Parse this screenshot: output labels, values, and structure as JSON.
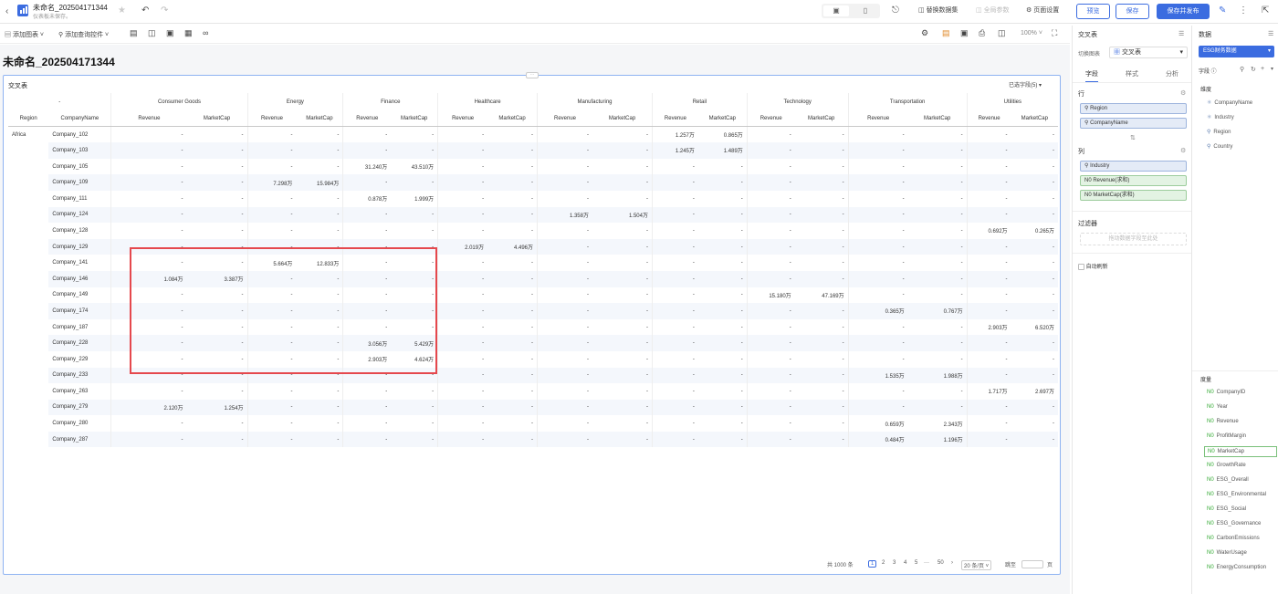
{
  "app": {
    "title": "未命名_202504171344",
    "subtitle": "仪表板未保存。"
  },
  "header": {
    "actions": {
      "replace_dataset": "替换数据集",
      "global_params": "全局参数",
      "page_settings": "页面设置"
    },
    "buttons": {
      "preview": "预览",
      "save": "保存",
      "save_publish": "保存并发布"
    }
  },
  "toolbar": {
    "add_chart": "添加图表",
    "add_query_control": "添加查询控件",
    "zoom": "100%"
  },
  "page": {
    "title": "未命名_202504171344"
  },
  "widget": {
    "title": "交叉表",
    "selected_fields": "已选字段(5)"
  },
  "pivot": {
    "corner": "-",
    "industries": [
      "Consumer Goods",
      "Energy",
      "Finance",
      "Healthcare",
      "Manufacturing",
      "Retail",
      "Technology",
      "Transportation",
      "Utilities"
    ],
    "row_headers": [
      "Region",
      "CompanyName"
    ],
    "measures": [
      "Revenue",
      "MarketCap"
    ],
    "region": "Africa",
    "rows": [
      {
        "company": "Company_102",
        "vals": [
          "-",
          "-",
          "-",
          "-",
          "-",
          "-",
          "-",
          "-",
          "-",
          "-",
          "1.257万",
          "0.865万",
          "-",
          "-",
          "-",
          "-",
          "-",
          "-"
        ]
      },
      {
        "company": "Company_103",
        "vals": [
          "-",
          "-",
          "-",
          "-",
          "-",
          "-",
          "-",
          "-",
          "-",
          "-",
          "1.245万",
          "1.489万",
          "-",
          "-",
          "-",
          "-",
          "-",
          "-"
        ]
      },
      {
        "company": "Company_105",
        "vals": [
          "-",
          "-",
          "-",
          "-",
          "31.240万",
          "43.510万",
          "-",
          "-",
          "-",
          "-",
          "-",
          "-",
          "-",
          "-",
          "-",
          "-",
          "-",
          "-"
        ]
      },
      {
        "company": "Company_109",
        "vals": [
          "-",
          "-",
          "7.298万",
          "15.984万",
          "-",
          "-",
          "-",
          "-",
          "-",
          "-",
          "-",
          "-",
          "-",
          "-",
          "-",
          "-",
          "-",
          "-"
        ]
      },
      {
        "company": "Company_111",
        "vals": [
          "-",
          "-",
          "-",
          "-",
          "0.878万",
          "1.999万",
          "-",
          "-",
          "-",
          "-",
          "-",
          "-",
          "-",
          "-",
          "-",
          "-",
          "-",
          "-"
        ]
      },
      {
        "company": "Company_124",
        "vals": [
          "-",
          "-",
          "-",
          "-",
          "-",
          "-",
          "-",
          "-",
          "1.358万",
          "1.504万",
          "-",
          "-",
          "-",
          "-",
          "-",
          "-",
          "-",
          "-"
        ]
      },
      {
        "company": "Company_128",
        "vals": [
          "-",
          "-",
          "-",
          "-",
          "-",
          "-",
          "-",
          "-",
          "-",
          "-",
          "-",
          "-",
          "-",
          "-",
          "-",
          "-",
          "0.692万",
          "0.265万"
        ]
      },
      {
        "company": "Company_129",
        "vals": [
          "-",
          "-",
          "-",
          "-",
          "-",
          "-",
          "2.019万",
          "4.496万",
          "-",
          "-",
          "-",
          "-",
          "-",
          "-",
          "-",
          "-",
          "-",
          "-"
        ]
      },
      {
        "company": "Company_141",
        "vals": [
          "-",
          "-",
          "5.664万",
          "12.833万",
          "-",
          "-",
          "-",
          "-",
          "-",
          "-",
          "-",
          "-",
          "-",
          "-",
          "-",
          "-",
          "-",
          "-"
        ]
      },
      {
        "company": "Company_146",
        "vals": [
          "1.084万",
          "3.387万",
          "-",
          "-",
          "-",
          "-",
          "-",
          "-",
          "-",
          "-",
          "-",
          "-",
          "-",
          "-",
          "-",
          "-",
          "-",
          "-"
        ]
      },
      {
        "company": "Company_149",
        "vals": [
          "-",
          "-",
          "-",
          "-",
          "-",
          "-",
          "-",
          "-",
          "-",
          "-",
          "-",
          "-",
          "15.180万",
          "47.169万",
          "-",
          "-",
          "-",
          "-"
        ]
      },
      {
        "company": "Company_174",
        "vals": [
          "-",
          "-",
          "-",
          "-",
          "-",
          "-",
          "-",
          "-",
          "-",
          "-",
          "-",
          "-",
          "-",
          "-",
          "0.365万",
          "0.767万",
          "-",
          "-"
        ]
      },
      {
        "company": "Company_187",
        "vals": [
          "-",
          "-",
          "-",
          "-",
          "-",
          "-",
          "-",
          "-",
          "-",
          "-",
          "-",
          "-",
          "-",
          "-",
          "-",
          "-",
          "2.903万",
          "6.520万"
        ]
      },
      {
        "company": "Company_228",
        "vals": [
          "-",
          "-",
          "-",
          "-",
          "3.056万",
          "5.429万",
          "-",
          "-",
          "-",
          "-",
          "-",
          "-",
          "-",
          "-",
          "-",
          "-",
          "-",
          "-"
        ]
      },
      {
        "company": "Company_229",
        "vals": [
          "-",
          "-",
          "-",
          "-",
          "2.903万",
          "4.624万",
          "-",
          "-",
          "-",
          "-",
          "-",
          "-",
          "-",
          "-",
          "-",
          "-",
          "-",
          "-"
        ]
      },
      {
        "company": "Company_233",
        "vals": [
          "-",
          "-",
          "-",
          "-",
          "-",
          "-",
          "-",
          "-",
          "-",
          "-",
          "-",
          "-",
          "-",
          "-",
          "1.535万",
          "1.988万",
          "-",
          "-"
        ]
      },
      {
        "company": "Company_263",
        "vals": [
          "-",
          "-",
          "-",
          "-",
          "-",
          "-",
          "-",
          "-",
          "-",
          "-",
          "-",
          "-",
          "-",
          "-",
          "-",
          "-",
          "1.717万",
          "2.697万"
        ]
      },
      {
        "company": "Company_279",
        "vals": [
          "2.120万",
          "1.254万",
          "-",
          "-",
          "-",
          "-",
          "-",
          "-",
          "-",
          "-",
          "-",
          "-",
          "-",
          "-",
          "-",
          "-",
          "-",
          "-"
        ]
      },
      {
        "company": "Company_280",
        "vals": [
          "-",
          "-",
          "-",
          "-",
          "-",
          "-",
          "-",
          "-",
          "-",
          "-",
          "-",
          "-",
          "-",
          "-",
          "0.659万",
          "2.343万",
          "-",
          "-"
        ]
      },
      {
        "company": "Company_287",
        "vals": [
          "-",
          "-",
          "-",
          "-",
          "-",
          "-",
          "-",
          "-",
          "-",
          "-",
          "-",
          "-",
          "-",
          "-",
          "0.484万",
          "1.196万",
          "-",
          "-"
        ]
      }
    ]
  },
  "pagination": {
    "total": "共 1000 条",
    "pages": [
      "1",
      "2",
      "3",
      "4",
      "5",
      "···",
      "50"
    ],
    "page_size": "20 条/页",
    "goto": "跳至",
    "page_unit": "页"
  },
  "config": {
    "title": "交叉表",
    "switch_chart": "切换图表",
    "chart_type": "交叉表",
    "tabs": [
      "字段",
      "样式",
      "分析"
    ],
    "rows_label": "行",
    "row_fields": [
      "Region",
      "CompanyName"
    ],
    "cols_label": "列",
    "col_fields": [
      "Industry",
      "Revenue(求和)",
      "MarketCap(求和)"
    ],
    "filter_label": "过滤器",
    "filter_placeholder": "拖动数据字段至此处",
    "auto_refresh": "自动刷新"
  },
  "data_panel": {
    "title": "数据",
    "dataset": "ESG财务数据",
    "fields_label": "字段",
    "dimensions_label": "维度",
    "dimensions": [
      "CompanyName",
      "Industry",
      "Region",
      "Country"
    ],
    "measures_label": "度量",
    "measures": [
      "CompanyID",
      "Year",
      "Revenue",
      "ProfitMargin",
      "MarketCap",
      "GrowthRate",
      "ESG_Overall",
      "ESG_Environmental",
      "ESG_Social",
      "ESG_Governance",
      "CarbonEmissions",
      "WaterUsage",
      "EnergyConsumption"
    ]
  }
}
